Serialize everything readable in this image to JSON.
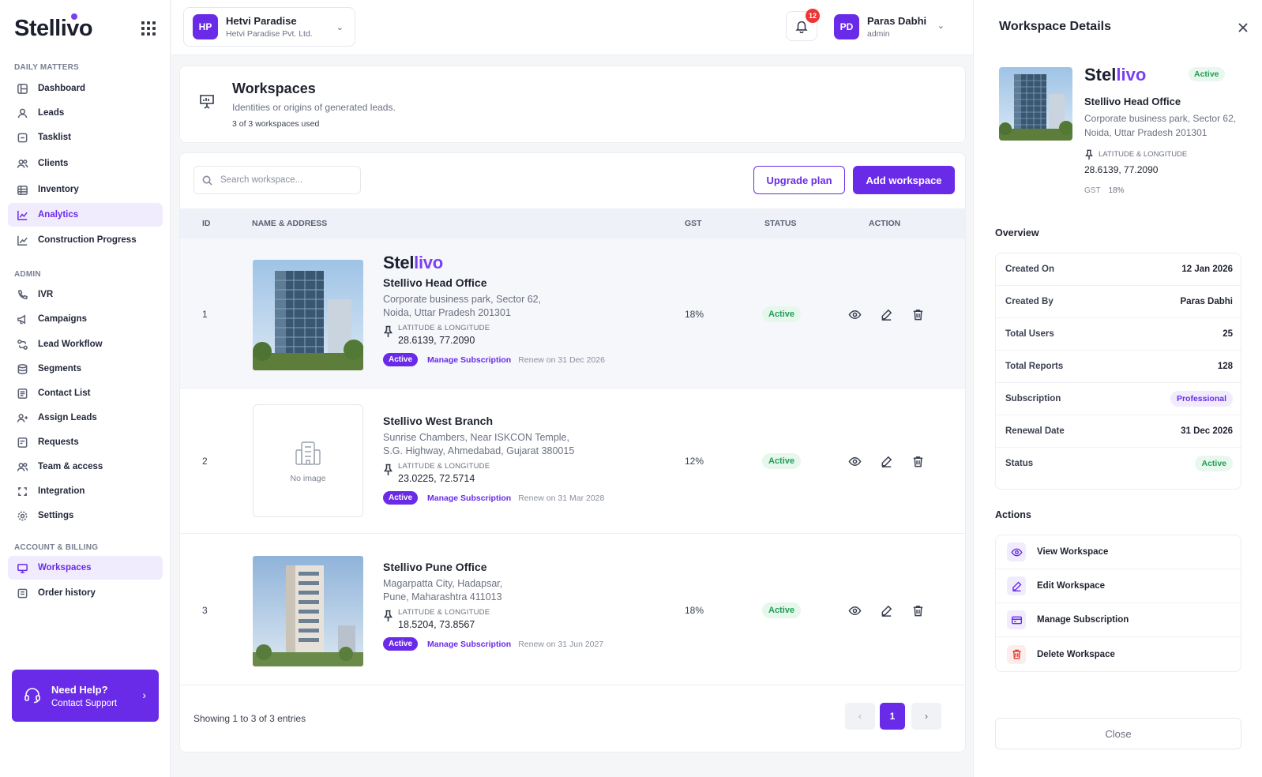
{
  "brand": {
    "name": "Stellivo"
  },
  "sidebar": {
    "sections": [
      {
        "label": "DAILY MATTERS"
      },
      {
        "label": "ADMIN"
      },
      {
        "label": "ACCOUNT & BILLING"
      }
    ],
    "items": [
      {
        "label": "Dashboard",
        "icon": "dashboard-icon"
      },
      {
        "label": "Leads",
        "icon": "users-icon"
      },
      {
        "label": "Tasklist",
        "icon": "checkbox-icon"
      },
      {
        "label": "Clients",
        "icon": "clients-icon"
      },
      {
        "label": "Inventory",
        "icon": "inventory-icon"
      },
      {
        "label": "Analytics",
        "icon": "chart-icon",
        "active": true
      },
      {
        "label": "Construction Progress",
        "icon": "trend-icon"
      },
      {
        "label": "IVR",
        "icon": "ivr-icon"
      },
      {
        "label": "Campaigns",
        "icon": "megaphone-icon"
      },
      {
        "label": "Lead Workflow",
        "icon": "workflow-icon"
      },
      {
        "label": "Segments",
        "icon": "segments-icon"
      },
      {
        "label": "Contact List",
        "icon": "contact-list-icon"
      },
      {
        "label": "Assign Leads",
        "icon": "assign-icon"
      },
      {
        "label": "Requests",
        "icon": "requests-icon"
      },
      {
        "label": "Team & access",
        "icon": "team-icon"
      },
      {
        "label": "Integration",
        "icon": "integration-icon"
      },
      {
        "label": "Settings",
        "icon": "gear-icon"
      },
      {
        "label": "Workspaces",
        "icon": "monitor-icon",
        "active": true
      },
      {
        "label": "Order history",
        "icon": "order-icon"
      }
    ],
    "help": {
      "title": "Need Help?",
      "subtitle": "Contact Support"
    }
  },
  "header": {
    "org_initials": "HP",
    "org_name": "Hetvi Paradise",
    "org_sub": "Hetvi Paradise Pvt. Ltd.",
    "notifications": "12",
    "user_initials": "PD",
    "user_name": "Paras Dabhi",
    "user_role": "admin"
  },
  "workspaces": {
    "title": "Workspaces",
    "subtitle": "Identities or origins of generated leads.",
    "usage": "3 of 3 workspaces used",
    "search_placeholder": "Search workspace...",
    "upgrade_label": "Upgrade plan",
    "add_label": "Add workspace",
    "columns": {
      "id": "ID",
      "name": "NAME & ADDRESS",
      "gst": "GST",
      "status": "STATUS",
      "action": "ACTION"
    },
    "latlng_label": "LATITUDE & LONGITUDE",
    "manage_label": "Manage Subscription",
    "no_image": "No image",
    "rows": [
      {
        "id": "1",
        "brand_a": "Stel",
        "brand_b": "livo",
        "name": "Stellivo Head Office",
        "addr1": "Corporate business park, Sector 62,",
        "addr2": "Noida, Uttar Pradesh 201301",
        "latlng": "28.6139, 77.2090",
        "sub_status": "Active",
        "renew": "Renew on 31 Dec 2026",
        "gst": "18%",
        "status": "Active"
      },
      {
        "id": "2",
        "name": "Stellivo West Branch",
        "addr1": "Sunrise Chambers, Near ISKCON Temple,",
        "addr2": "S.G. Highway, Ahmedabad, Gujarat 380015",
        "latlng": "23.0225, 72.5714",
        "sub_status": "Active",
        "renew": "Renew on 31 Mar 2028",
        "gst": "12%",
        "status": "Active"
      },
      {
        "id": "3",
        "name": "Stellivo Pune Office",
        "addr1": "Magarpatta City, Hadapsar,",
        "addr2": "Pune, Maharashtra 411013",
        "latlng": "18.5204, 73.8567",
        "sub_status": "Active",
        "renew": "Renew on 31 Jun 2027",
        "gst": "18%",
        "status": "Active"
      }
    ],
    "footer": "Showing 1 to 3 of 3 entries",
    "current_page": "1"
  },
  "details": {
    "title": "Workspace Details",
    "brand_a": "Stel",
    "brand_b": "livo",
    "status": "Active",
    "name": "Stellivo Head Office",
    "addr1": "Corporate business park, Sector 62,",
    "addr2": "Noida, Uttar Pradesh 201301",
    "latlng_label": "LATITUDE & LONGITUDE",
    "latlng": "28.6139, 77.2090",
    "gst_label": "GST",
    "gst": "18%",
    "overview_title": "Overview",
    "overview": [
      {
        "k": "Created On",
        "v": "12 Jan 2026"
      },
      {
        "k": "Created By",
        "v": "Paras Dabhi"
      },
      {
        "k": "Total Users",
        "v": "25"
      },
      {
        "k": "Total Reports",
        "v": "128"
      },
      {
        "k": "Subscription",
        "v": "Professional"
      },
      {
        "k": "Renewal Date",
        "v": "31 Dec 2026"
      },
      {
        "k": "Status",
        "v": "Active"
      }
    ],
    "actions_title": "Actions",
    "actions": [
      {
        "label": "View Workspace",
        "icon": "eye-icon"
      },
      {
        "label": "Edit Workspace",
        "icon": "pencil-icon"
      },
      {
        "label": "Manage Subscription",
        "icon": "card-icon"
      },
      {
        "label": "Delete Workspace",
        "icon": "trash-icon"
      }
    ],
    "close_label": "Close"
  },
  "colors": {
    "accent": "#6a2be8",
    "success": "#1f9d55",
    "danger": "#ef3434"
  }
}
